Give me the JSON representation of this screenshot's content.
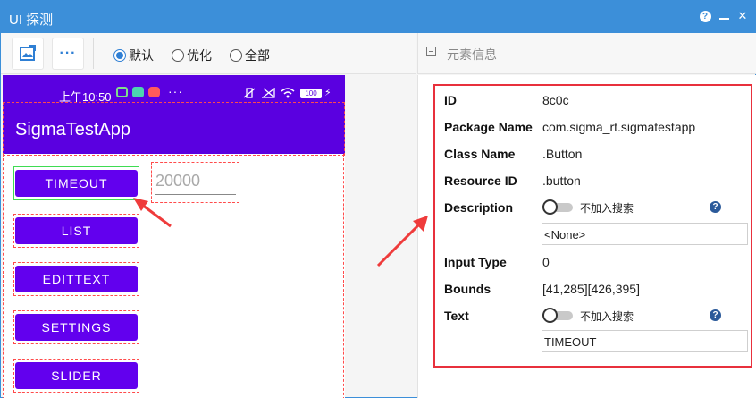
{
  "window": {
    "title": "UI 探测"
  },
  "titlebar": {
    "help": "?",
    "close": "✕"
  },
  "toolbar": {
    "more_label": "···",
    "modes": [
      {
        "label": "默认",
        "selected": true
      },
      {
        "label": "优化",
        "selected": false
      },
      {
        "label": "全部",
        "selected": false
      }
    ]
  },
  "phone": {
    "status_time": "上午10:50",
    "status_more": "···",
    "battery": "100",
    "app_title": "SigmaTestApp",
    "buttons": [
      "TIMEOUT",
      "LIST",
      "EDITTEXT",
      "SETTINGS",
      "SLIDER"
    ],
    "edit_value": "20000"
  },
  "panel": {
    "title": "元素信息",
    "props": {
      "id": {
        "label": "ID",
        "value": "8c0c"
      },
      "package": {
        "label": "Package Name",
        "value": "com.sigma_rt.sigmatestapp"
      },
      "class": {
        "label": "Class Name",
        "value": ".Button"
      },
      "resource": {
        "label": "Resource ID",
        "value": ".button"
      },
      "description": {
        "label": "Description",
        "toggle_label": "不加入搜索",
        "value": "<None>"
      },
      "input_type": {
        "label": "Input Type",
        "value": "0"
      },
      "bounds": {
        "label": "Bounds",
        "value": "[41,285][426,395]"
      },
      "text": {
        "label": "Text",
        "toggle_label": "不加入搜索",
        "value": "TIMEOUT"
      }
    }
  },
  "colors": {
    "accent": "#3c8fd9",
    "app_primary": "#6200ee",
    "highlight": "#e8303c",
    "selected_outline": "#3fdc52"
  }
}
